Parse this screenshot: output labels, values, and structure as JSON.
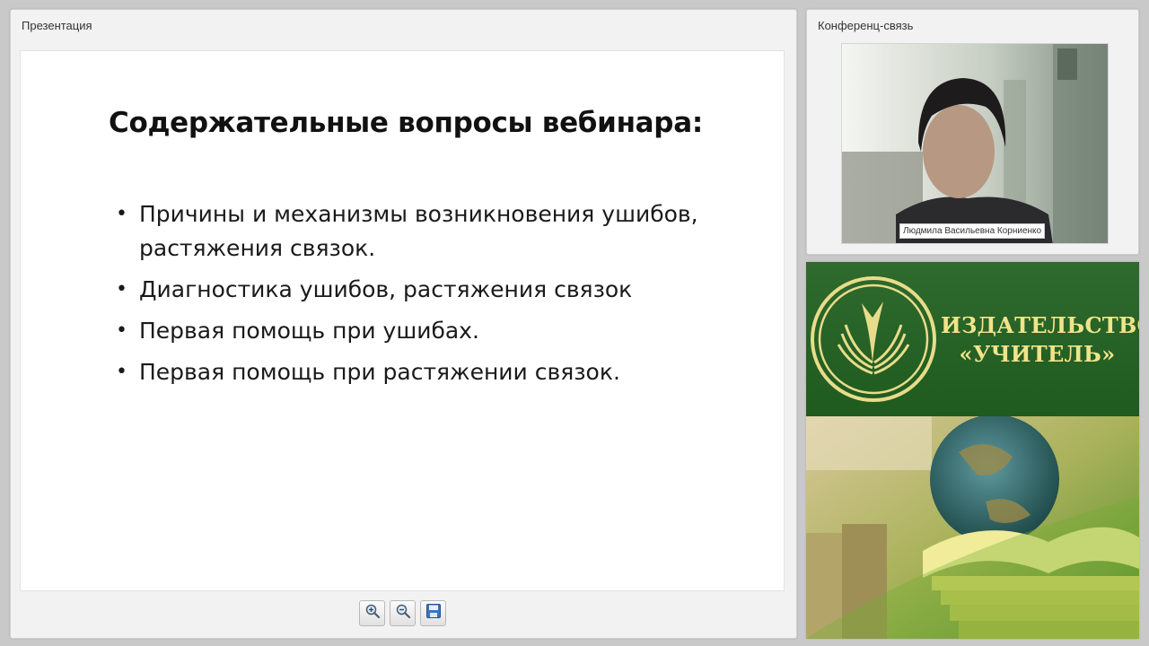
{
  "presentation": {
    "panel_title": "Презентация",
    "slide_title": "Содержательные вопросы вебинара:",
    "bullets": [
      "Причины и механизмы возникновения ушибов, растяжения связок.",
      "Диагностика ушибов, растяжения связок",
      "Первая помощь при ушибах.",
      "Первая помощь при растяжении связок."
    ],
    "bullet_char": "•",
    "toolbar": [
      "zoom-in-icon",
      "zoom-out-icon",
      "save-icon"
    ]
  },
  "conference": {
    "panel_title": "Конференц-связь",
    "participant_name": "Людмила Васильевна Корниенко"
  },
  "banner": {
    "publisher_line1": "ИЗДАТЕЛЬСТВО",
    "publisher_line2": "«УЧИТЕЛЬ»",
    "colors": {
      "green": "#2f6a2e",
      "gold": "#f0e48a"
    }
  }
}
